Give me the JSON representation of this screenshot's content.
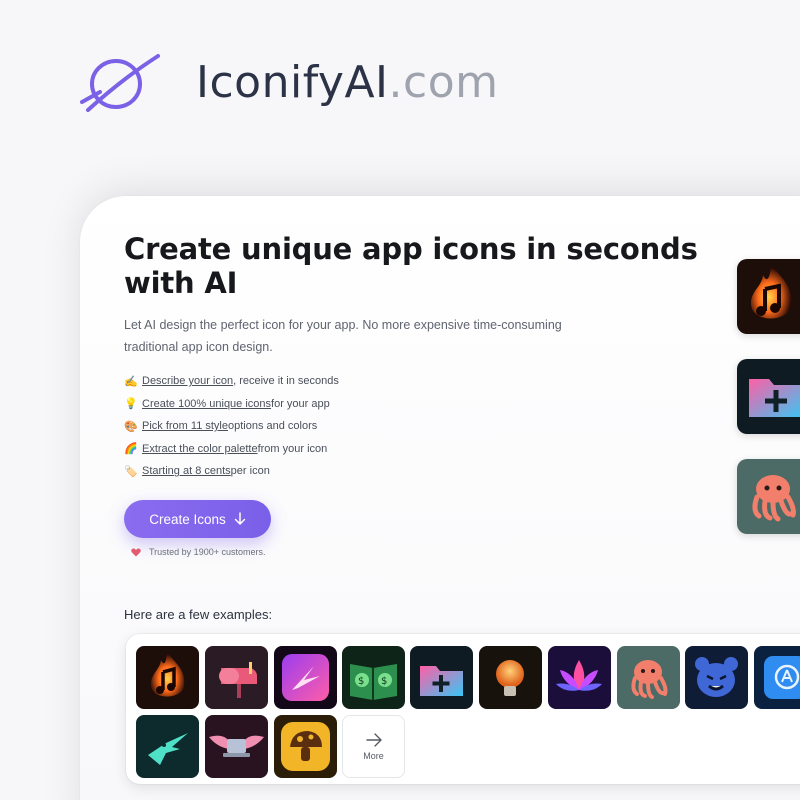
{
  "brand": {
    "name": "IconifyAI",
    "tld": ".com",
    "logo_icon": "feather-circle-icon",
    "accent": "#7b61e6"
  },
  "hero": {
    "headline": "Create unique app icons in seconds with AI",
    "subtitle": "Let AI design the perfect icon for your app. No more expensive time-consuming traditional app icon design."
  },
  "features": [
    {
      "emoji": "✍️",
      "link": "Describe your icon",
      "rest": ", receive it in seconds"
    },
    {
      "emoji": "💡",
      "link": "Create 100% unique icons",
      "rest": " for your app"
    },
    {
      "emoji": "🎨",
      "link": "Pick from 11 style",
      "rest": " options and colors"
    },
    {
      "emoji": "🌈",
      "link": "Extract the color palette",
      "rest": " from your icon"
    },
    {
      "emoji": "🏷️",
      "link": "Starting at 8 cents",
      "rest": " per icon"
    }
  ],
  "cta": {
    "label": "Create Icons",
    "icon": "arrow-down-icon"
  },
  "trusted": {
    "text": "Trusted by 1900+ customers.",
    "icon": "heart-icon"
  },
  "examples": {
    "label": "Here are a few examples:",
    "more_label": "More",
    "tiles": [
      "flaming-music-note-icon",
      "mailbox-icon",
      "hummingbird-icon",
      "money-book-icon",
      "folder-plus-icon",
      "lightbulb-icon",
      "lotus-icon",
      "octopus-icon",
      "bear-icon",
      "app-store-book-icon",
      "hummingbird-teal-icon",
      "winged-laptop-icon",
      "mushroom-badge-icon"
    ]
  },
  "side_previews": [
    "flaming-music-note-icon",
    "folder-plus-icon",
    "octopus-icon"
  ]
}
